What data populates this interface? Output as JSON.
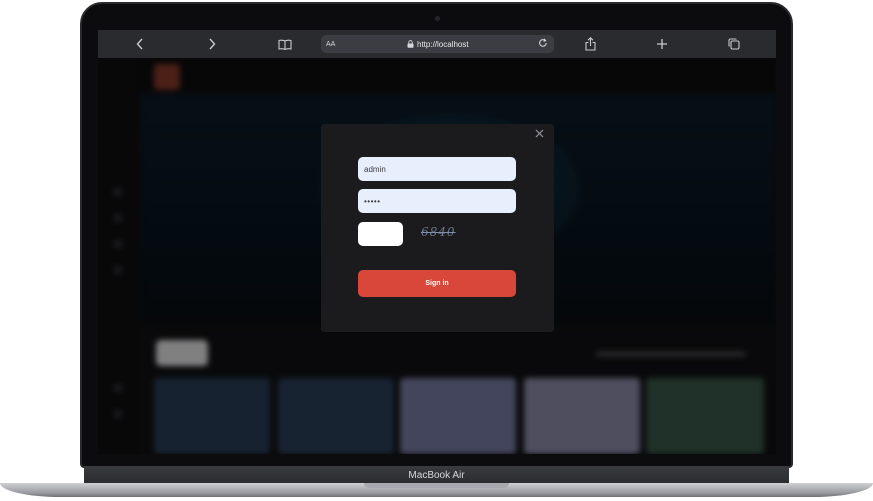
{
  "browser": {
    "text_size_label": "AA",
    "url": "http://localhost",
    "back_icon": "chevron-left",
    "forward_icon": "chevron-right",
    "bookmarks_icon": "book",
    "lock_icon": "lock",
    "reload_icon": "reload",
    "share_icon": "share",
    "new_tab_icon": "plus",
    "tabs_icon": "tabs"
  },
  "login": {
    "username_value": "admin",
    "password_value": "•••••",
    "captcha_code": "6840",
    "signin_label": "Sign in",
    "close_icon": "close"
  },
  "device": {
    "label": "MacBook Air"
  },
  "colors": {
    "signin_button": "#d9473a",
    "field_background": "#e8effc",
    "modal_background": "#1b1b1e"
  }
}
